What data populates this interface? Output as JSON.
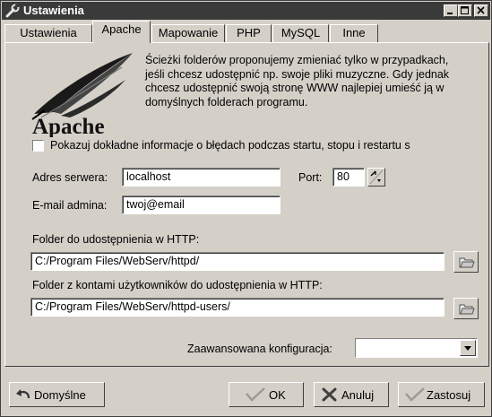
{
  "window": {
    "title": "Ustawienia",
    "icons": [
      "wrench-icon",
      "minimize-icon",
      "maximize-icon",
      "close-icon"
    ]
  },
  "tabs": [
    {
      "label": "Ustawienia",
      "active": false
    },
    {
      "label": "Apache",
      "active": true
    },
    {
      "label": "Mapowanie",
      "active": false
    },
    {
      "label": "PHP",
      "active": false
    },
    {
      "label": "MySQL",
      "active": false
    },
    {
      "label": "Inne",
      "active": false
    }
  ],
  "apache": {
    "logo_text": "Apache",
    "intro_lines": [
      "Ścieżki folderów proponujemy zmieniać tylko w przypadkach,",
      "jeśli chcesz udostępnić np. swoje pliki muzyczne. Gdy jednak",
      "chcesz udostępnić swoją stronę WWW najlepiej umieść ją w",
      "domyślnych folderach programu."
    ],
    "detailed_errors": {
      "label": "Pokazuj dokładne informacje o błędach podczas startu, stopu i restartu s",
      "checked": false
    },
    "server_address": {
      "label": "Adres serwera:",
      "value": "localhost"
    },
    "port": {
      "label": "Port:",
      "value": "80"
    },
    "admin_email": {
      "label": "E-mail admina:",
      "value": "twoj@email"
    },
    "http_folder": {
      "label": "Folder do udostępnienia w HTTP:",
      "value": "C:/Program Files/WebServ/httpd/"
    },
    "users_folder": {
      "label": "Folder z kontami użytkowników do udostępnienia w HTTP:",
      "value": "C:/Program Files/WebServ/httpd-users/"
    },
    "advanced": {
      "label": "Zaawansowana konfiguracja:",
      "value": ""
    }
  },
  "buttons": {
    "defaults": "Domyślne",
    "ok": "OK",
    "cancel": "Anuluj",
    "apply": "Zastosuj"
  },
  "colors": {
    "face": "#d4d0c8",
    "titlebar": "#3a3a3a",
    "ok_check": "#9a9a9a",
    "cancel_x": "#404040"
  }
}
